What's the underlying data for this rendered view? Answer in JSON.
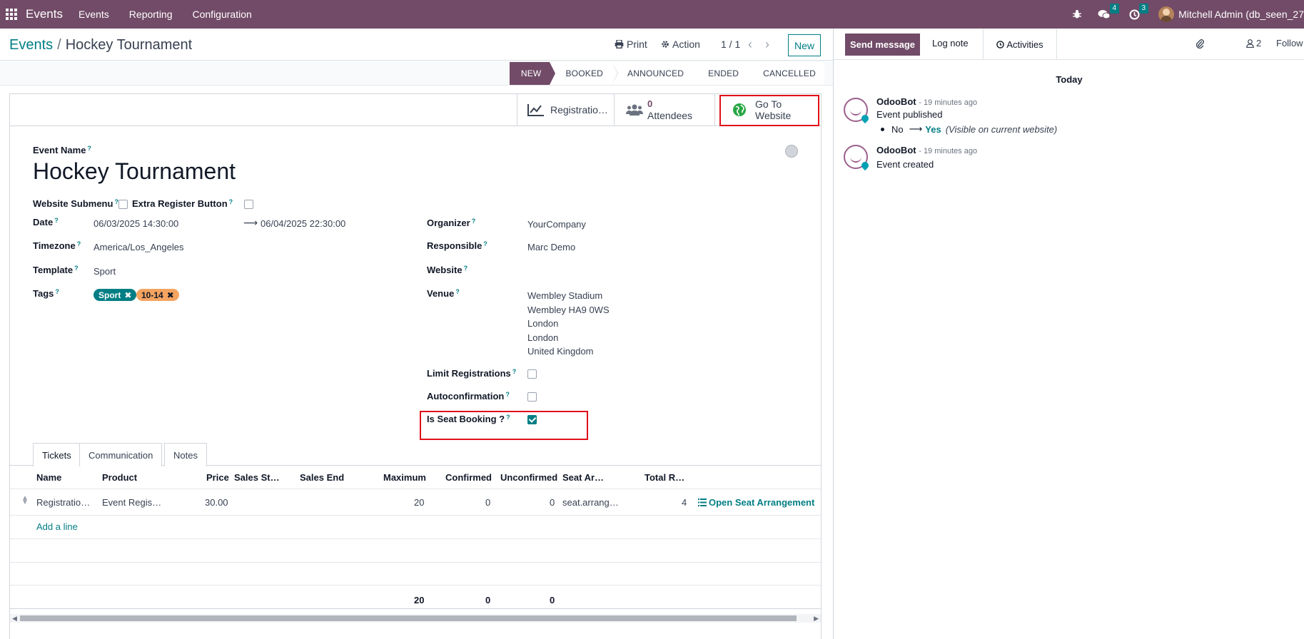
{
  "navbar": {
    "app_name": "Events",
    "menus": [
      "Events",
      "Reporting",
      "Configuration"
    ],
    "messages_count": "4",
    "activities_count": "3",
    "user": "Mitchell Admin (db_seen_27"
  },
  "control": {
    "breadcrumb_parent": "Events",
    "breadcrumb_current": "Hockey Tournament",
    "print_label": "Print",
    "action_label": "Action",
    "pager": "1 / 1",
    "new_label": "New"
  },
  "stages": [
    {
      "label": "NEW",
      "active": true
    },
    {
      "label": "BOOKED",
      "active": false
    },
    {
      "label": "ANNOUNCED",
      "active": false
    },
    {
      "label": "ENDED",
      "active": false
    },
    {
      "label": "CANCELLED",
      "active": false
    }
  ],
  "smart_buttons": {
    "registrations_label": "Registratio…",
    "attendees_count": "0",
    "attendees_label": "Attendees",
    "website_line1": "Go To",
    "website_line2": "Website"
  },
  "form": {
    "event_name_label": "Event Name",
    "event_name": "Hockey Tournament",
    "website_submenu_label": "Website Submenu",
    "website_submenu": false,
    "extra_register_label": "Extra Register Button",
    "extra_register": false,
    "date_label": "Date",
    "date_begin": "06/03/2025 14:30:00",
    "date_end": "06/04/2025 22:30:00",
    "timezone_label": "Timezone",
    "timezone": "America/Los_Angeles",
    "template_label": "Template",
    "template": "Sport",
    "tags_label": "Tags",
    "tags": [
      {
        "name": "Sport",
        "color": "#017e84",
        "text": "#ffffff"
      },
      {
        "name": "10-14",
        "color": "#f4a460",
        "text": "#111827"
      }
    ],
    "organizer_label": "Organizer",
    "organizer": "YourCompany",
    "responsible_label": "Responsible",
    "responsible": "Marc Demo",
    "website_label": "Website",
    "venue_label": "Venue",
    "venue_lines": [
      "Wembley Stadium",
      "Wembley HA9 0WS",
      "London",
      "London",
      "United Kingdom"
    ],
    "limit_label": "Limit Registrations",
    "limit": false,
    "autoconfirm_label": "Autoconfirmation",
    "autoconfirm": false,
    "seat_booking_label": "Is Seat Booking ?",
    "seat_booking": true
  },
  "tabs": [
    {
      "label": "Tickets",
      "active": true
    },
    {
      "label": "Communication",
      "active": false
    },
    {
      "label": "Notes",
      "active": false
    }
  ],
  "tickets": {
    "headers": [
      "Name",
      "Product",
      "Price",
      "Sales St…",
      "Sales End",
      "Maximum",
      "Confirmed",
      "Unconfirmed",
      "Seat Ar…",
      "Total R…"
    ],
    "rows": [
      {
        "name": "Registratio…",
        "product": "Event Regis…",
        "price": "30.00",
        "sales_start": "",
        "sales_end": "",
        "maximum": "20",
        "confirmed": "0",
        "unconfirmed": "0",
        "seat": "seat.arrang…",
        "total": "4",
        "action": "Open Seat Arrangement"
      }
    ],
    "add_line": "Add a line",
    "totals": {
      "maximum": "20",
      "confirmed": "0",
      "unconfirmed": "0"
    }
  },
  "chatter": {
    "send_message": "Send message",
    "log_note": "Log note",
    "activities": "Activities",
    "followers_count": "2",
    "follow_label": "Follow",
    "today_label": "Today",
    "messages": [
      {
        "author": "OdooBot",
        "time": "- 19 minutes ago",
        "body": "Event published",
        "change_old": "No",
        "change_new": "Yes",
        "change_note": "(Visible on current website)"
      },
      {
        "author": "OdooBot",
        "time": "- 19 minutes ago",
        "body": "Event created"
      }
    ]
  }
}
